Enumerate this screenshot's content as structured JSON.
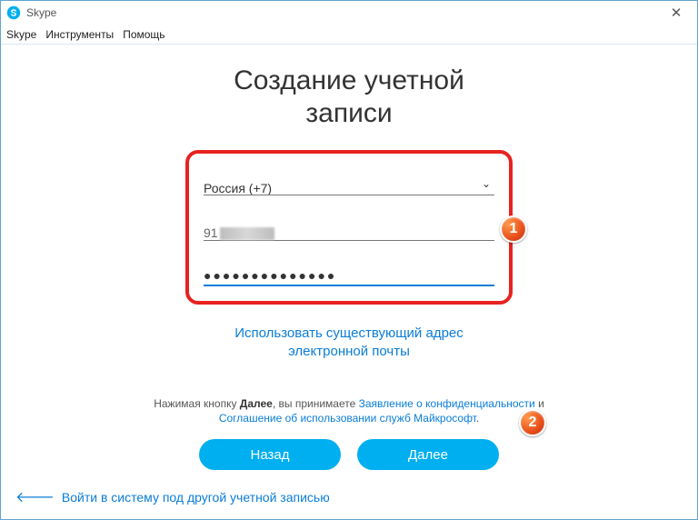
{
  "titlebar": {
    "app_name": "Skype"
  },
  "menubar": {
    "skype": "Skype",
    "tools": "Инструменты",
    "help": "Помощь"
  },
  "page": {
    "title_line1": "Создание учетной",
    "title_line2": "записи"
  },
  "form": {
    "country": "Россия (+7)",
    "phone_prefix": "91",
    "password_masked": "●●●●●●●●●●●●●●"
  },
  "links": {
    "use_existing_line1": "Использовать существующий адрес",
    "use_existing_line2": "электронной почты"
  },
  "tos": {
    "prefix": "Нажимая кнопку ",
    "bold": "Далее",
    "middle": ", вы принимаете ",
    "privacy": "Заявление о конфиденциальности",
    "and": " и ",
    "agreement": "Соглашение об использовании служб Майкрософт",
    "dot": "."
  },
  "buttons": {
    "back": "Назад",
    "next": "Далее"
  },
  "bottom": {
    "other_account": "Войти в систему под другой учетной записью"
  },
  "callouts": {
    "one": "1",
    "two": "2"
  }
}
